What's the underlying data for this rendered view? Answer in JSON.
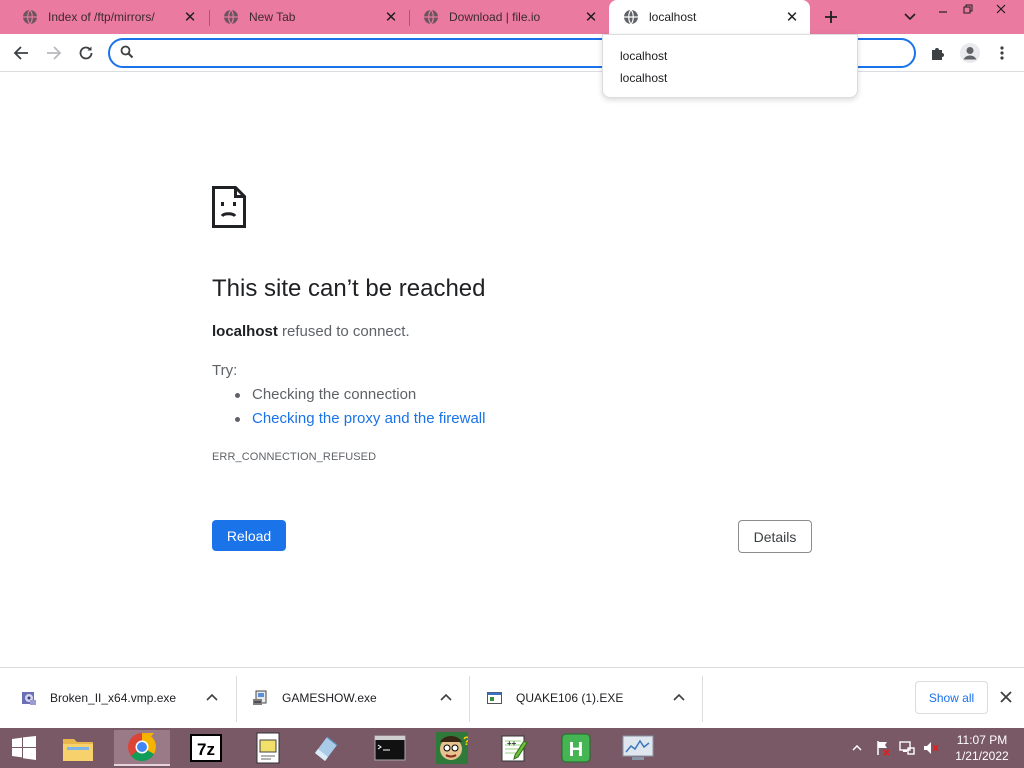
{
  "tabs": [
    {
      "label": "Index of /ftp/mirrors/",
      "active": false
    },
    {
      "label": "New Tab",
      "active": false
    },
    {
      "label": "Download | file.io",
      "active": false
    },
    {
      "label": "localhost",
      "active": true
    }
  ],
  "omnibox": {
    "value": "",
    "placeholder": ""
  },
  "autocomplete": [
    "localhost",
    "localhost"
  ],
  "error": {
    "title": "This site can’t be reached",
    "host": "localhost",
    "message": " refused to connect.",
    "try_label": "Try:",
    "suggestions": [
      "Checking the connection",
      "Checking the proxy and the firewall"
    ],
    "code": "ERR_CONNECTION_REFUSED",
    "reload_label": "Reload",
    "details_label": "Details"
  },
  "downloads": {
    "items": [
      {
        "name": "Broken_II_x64.vmp.exe",
        "icon": "installer-icon"
      },
      {
        "name": "GAMESHOW.exe",
        "icon": "setup-icon"
      },
      {
        "name": "QUAKE106 (1).EXE",
        "icon": "exe-window-icon"
      }
    ],
    "show_all_label": "Show all"
  },
  "taskbar": {
    "apps": [
      "file-explorer-icon",
      "chrome-icon",
      "7zip-icon",
      "notepad-doc-icon",
      "eraser-icon",
      "cmd-icon",
      "game-face-icon",
      "notepadpp-icon",
      "hxd-icon",
      "system-monitor-icon"
    ],
    "time": "11:07 PM",
    "date": "1/21/2022"
  },
  "colors": {
    "tabstrip": "#ea7aa0",
    "accent": "#1a73e8",
    "taskbar": "#7a5967"
  }
}
